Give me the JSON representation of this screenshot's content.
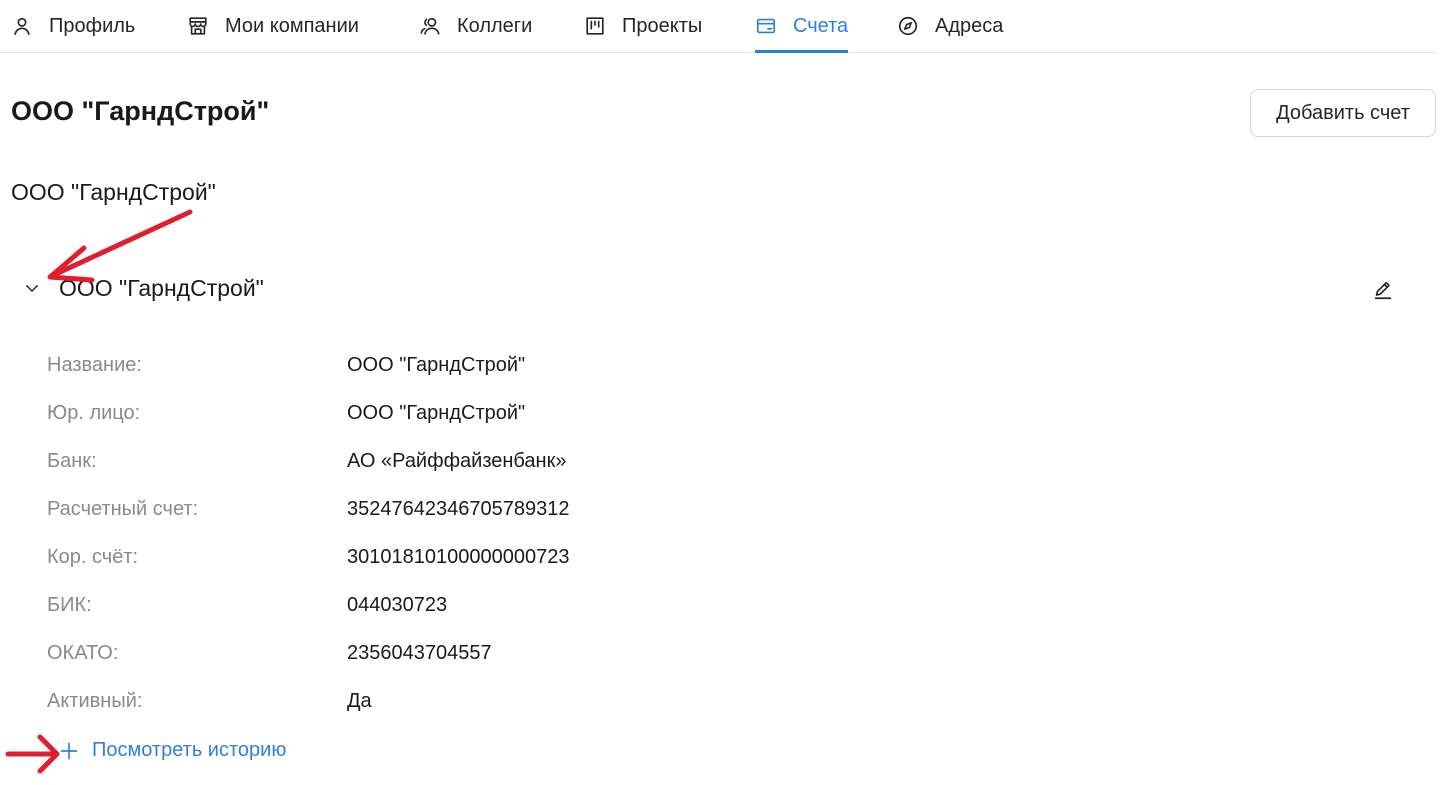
{
  "tabs": [
    {
      "label": "Профиль",
      "icon": "user-icon"
    },
    {
      "label": "Мои компании",
      "icon": "store-icon"
    },
    {
      "label": "Коллеги",
      "icon": "users-icon"
    },
    {
      "label": "Проекты",
      "icon": "board-icon"
    },
    {
      "label": "Счета",
      "icon": "card-icon",
      "active": true
    },
    {
      "label": "Адреса",
      "icon": "compass-icon"
    }
  ],
  "header": {
    "title": "ООО \"ГарндСтрой\"",
    "add_button_label": "Добавить счет"
  },
  "company_name": "ООО \"ГарндСтрой\"",
  "account": {
    "title": "ООО \"ГарндСтрой\"",
    "fields": [
      {
        "label": "Название:",
        "value": "ООО \"ГарндСтрой\""
      },
      {
        "label": "Юр. лицо:",
        "value": "ООО \"ГарндСтрой\""
      },
      {
        "label": "Банк:",
        "value": "АО «Райффайзенбанк»"
      },
      {
        "label": "Расчетный счет:",
        "value": "35247642346705789312"
      },
      {
        "label": "Кор. счёт:",
        "value": "30101810100000000723"
      },
      {
        "label": "БИК:",
        "value": "044030723"
      },
      {
        "label": "ОКАТО:",
        "value": "2356043704557"
      },
      {
        "label": "Активный:",
        "value": "Да"
      }
    ],
    "history_link_label": "Посмотреть историю"
  },
  "colors": {
    "accent": "#2f7fe0",
    "annotation": "#e01e2e",
    "label": "#8a8a8a"
  }
}
